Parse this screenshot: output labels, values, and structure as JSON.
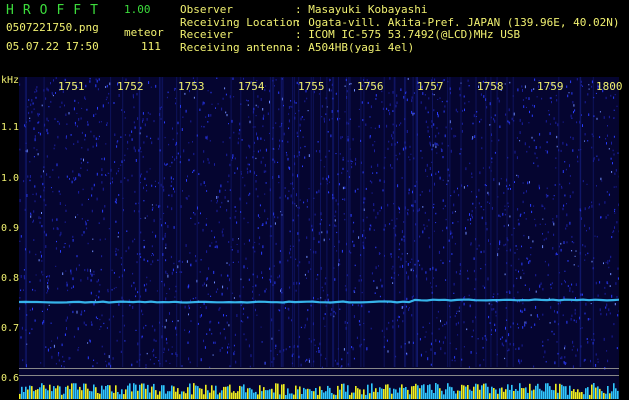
{
  "header": {
    "logo": "HROFFT",
    "version": "1.00",
    "filename": "0507221750.png",
    "datetime": "05.07.22 17:50",
    "meteor_label": "meteor",
    "meteor_count": "111"
  },
  "info": [
    {
      "key": "Observer",
      "value": ": Masayuki Kobayashi"
    },
    {
      "key": "Receiving Location",
      "value": ": Ogata-vill. Akita-Pref. JAPAN (139.96E, 40.02N)"
    },
    {
      "key": "Receiver",
      "value": ": ICOM IC-575 53.7492(@LCD)MHz USB"
    },
    {
      "key": "Receiving antenna",
      "value": ": A504HB(yagi 4el)"
    }
  ],
  "spectrogram": {
    "y_unit": "kHz",
    "y_ticks": [
      "1.1",
      "1.0",
      "0.9",
      "0.8",
      "0.7",
      "0.6"
    ],
    "time_ticks": [
      "1751",
      "1752",
      "1753",
      "1754",
      "1755",
      "1756",
      "1757",
      "1758",
      "1759",
      "1800"
    ],
    "signal_frequency_khz": 0.75,
    "colors": {
      "background": "#050530",
      "noise": "#2a3cff",
      "signal": "#3cc8ff",
      "labels": "#f0f070",
      "header_green": "#3cdc3c"
    }
  }
}
